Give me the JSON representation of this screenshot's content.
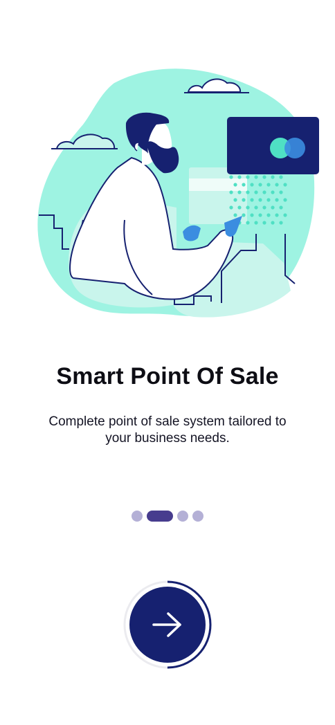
{
  "onboarding": {
    "title": "Smart Point Of Sale",
    "subtitle": "Complete point of sale system tailored to your business needs."
  },
  "pager": {
    "total": 4,
    "current_index": 1
  },
  "next_button": {
    "icon": "arrow-right-icon",
    "progress_fraction": 0.5
  },
  "colors": {
    "brand_navy": "#162170",
    "mint": "#9ef3e2",
    "mint_light": "#c9f5ec",
    "teal_dots": "#4fe0c4",
    "dot_inactive": "#b4b0d6",
    "dot_active": "#473c8e",
    "ring_track": "#ebebef",
    "glove_blue": "#3b8de0"
  }
}
